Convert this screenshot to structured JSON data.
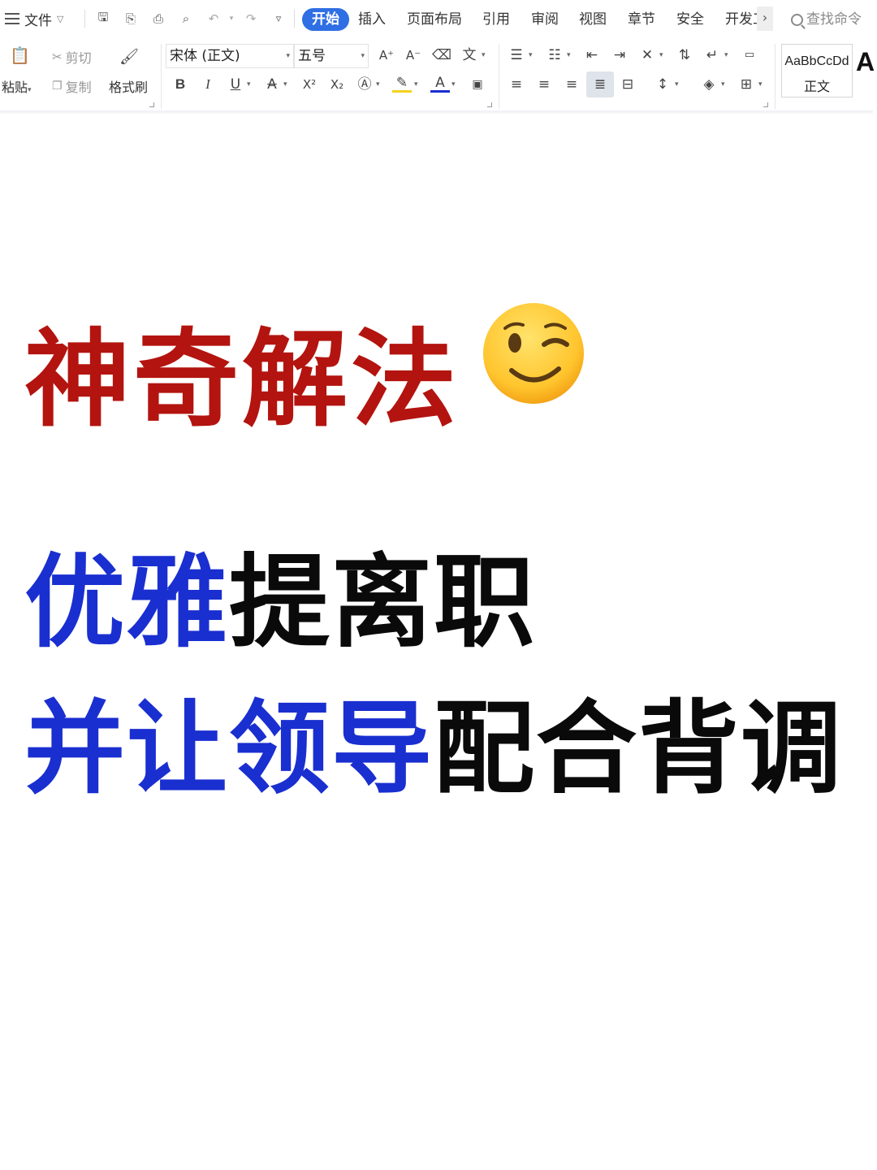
{
  "menu": {
    "file_label": "文件",
    "tabs": [
      {
        "label": "开始",
        "active": true
      },
      {
        "label": "插入"
      },
      {
        "label": "页面布局"
      },
      {
        "label": "引用"
      },
      {
        "label": "审阅"
      },
      {
        "label": "视图"
      },
      {
        "label": "章节"
      },
      {
        "label": "安全"
      },
      {
        "label": "开发工"
      }
    ],
    "more_arrow": "›",
    "search_label": "查找命令"
  },
  "clipboard": {
    "paste_label": "粘贴",
    "cut_label": "剪切",
    "copy_label": "复制",
    "format_painter_label": "格式刷"
  },
  "font": {
    "family": "宋体 (正文)",
    "size": "五号"
  },
  "styles": {
    "sample": "AaBbCcDd",
    "name": "正文",
    "next_sample": "A"
  },
  "content": {
    "line1": "神奇解法",
    "line2_blue": "优雅",
    "line2_black": "提离职",
    "line3_blue": "并让领导",
    "line3_black": "配合背调"
  },
  "colors": {
    "accent": "#2f6fe4",
    "title_red": "#b3140f",
    "highlight_blue": "#1a2fd0",
    "text_black": "#0a0a0a"
  }
}
